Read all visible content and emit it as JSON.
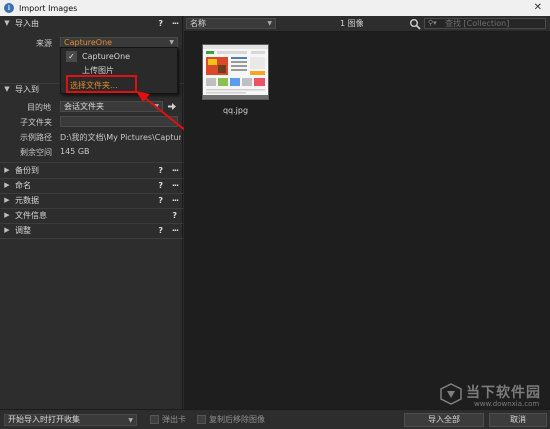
{
  "window": {
    "title": "Import Images",
    "close_glyph": "✕"
  },
  "left_panel": {
    "import_from": {
      "header": "导入由",
      "source_label": "来源",
      "source_value": "CaptureOne",
      "dropdown_options": [
        "CaptureOne",
        "上传图片",
        "选择文件夹..."
      ]
    },
    "import_to": {
      "header": "导入到",
      "destination_label": "目的地",
      "destination_value": "会话文件夹",
      "subfolder_label": "子文件夹",
      "subfolder_value": "",
      "sample_path_label": "示例路径",
      "sample_path_value": "D:\\我的文档\\My Pictures\\Capture...",
      "free_space_label": "剩余空间",
      "free_space_value": "145 GB"
    },
    "sections": [
      {
        "label": "备份到",
        "has_help": true,
        "has_menu": true
      },
      {
        "label": "命名",
        "has_help": true,
        "has_menu": true
      },
      {
        "label": "元数据",
        "has_help": true,
        "has_menu": true
      },
      {
        "label": "文件信息",
        "has_help": true,
        "has_menu": false
      },
      {
        "label": "调整",
        "has_help": true,
        "has_menu": true
      }
    ],
    "help_glyph": "?",
    "menu_glyph": "···"
  },
  "browser": {
    "sort_value": "名称",
    "count_text": "1 图像",
    "search_placeholder": "查找 [Collection]",
    "thumbnails": [
      {
        "filename": "qq.jpg"
      }
    ]
  },
  "bottom": {
    "after_import_value": "开始导入时打开收集",
    "eject_label": "弹出卡",
    "delete_label": "复制后移除图像",
    "import_all_label": "导入全部",
    "cancel_label": "取消"
  },
  "watermark": {
    "text": "当下软件园",
    "url": "www.downxia.com"
  },
  "colors": {
    "accent_orange": "#e28a2b",
    "annotation_red": "#e01010"
  }
}
